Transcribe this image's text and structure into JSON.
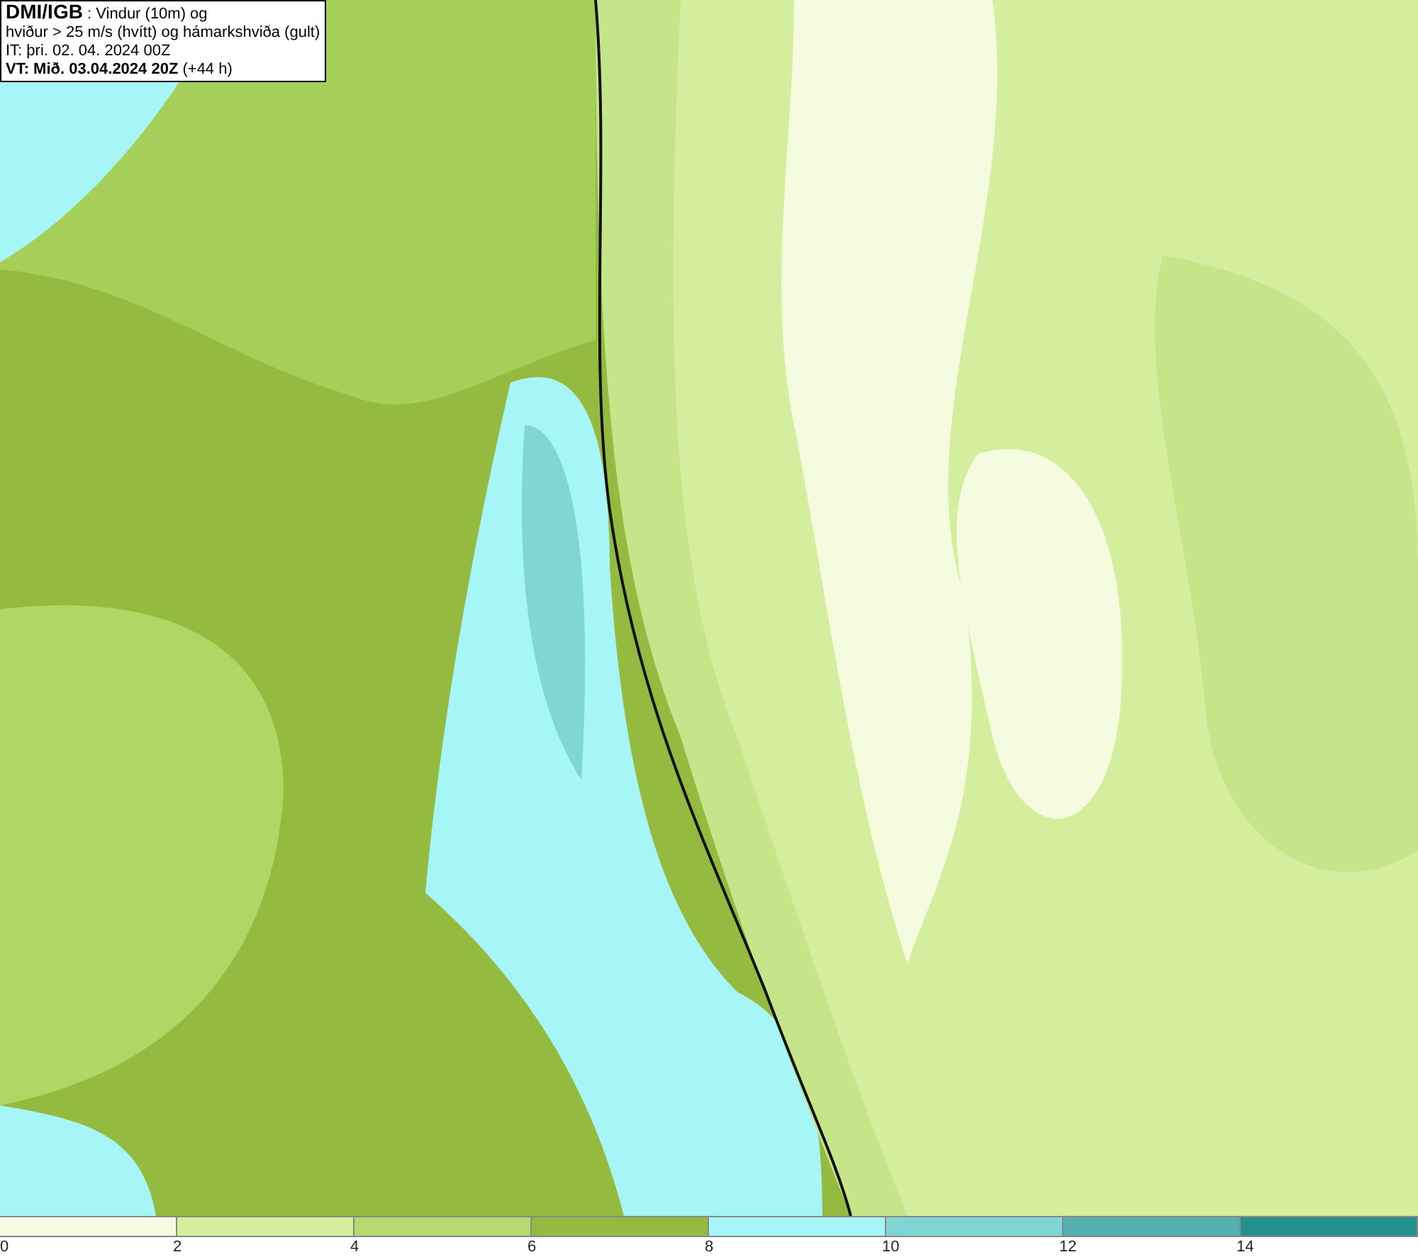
{
  "legend": {
    "lines": [
      "**DMI/IGB** : Vindur (10m) og",
      "hviður > 25 m/s (hvítt) og hámarkshviða (gult)",
      "IT: þri. 02. 04. 2024 00Z",
      "**VT: Mið. 03.04.2024 20Z** (+44 h)"
    ]
  },
  "colorbar": {
    "segments": [
      {
        "color": "#f4fbdf"
      },
      {
        "color": "#d5ee9e"
      },
      {
        "color": "#b6da70"
      },
      {
        "color": "#94bb40"
      },
      {
        "color": "#a6f5f7"
      },
      {
        "color": "#80d5d5"
      },
      {
        "color": "#56b0b0"
      },
      {
        "color": "#22908e"
      }
    ],
    "ticks": [
      "0",
      "2",
      "4",
      "6",
      "8",
      "10",
      "12",
      "14"
    ]
  }
}
